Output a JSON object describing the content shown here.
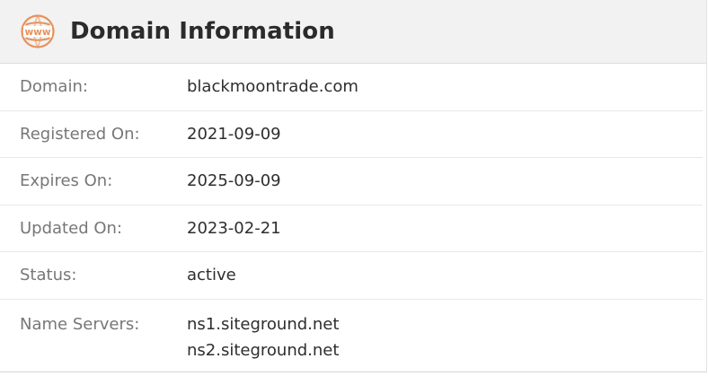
{
  "header": {
    "title": "Domain Information",
    "icon": "www-globe-icon",
    "icon_text": "www",
    "accent": "#e8915a"
  },
  "rows": [
    {
      "label": "Domain:",
      "value": "blackmoontrade.com"
    },
    {
      "label": "Registered On:",
      "value": "2021-09-09"
    },
    {
      "label": "Expires On:",
      "value": "2025-09-09"
    },
    {
      "label": "Updated On:",
      "value": "2023-02-21"
    },
    {
      "label": "Status:",
      "value": "active"
    }
  ],
  "name_servers": {
    "label": "Name Servers:",
    "values": [
      "ns1.siteground.net",
      "ns2.siteground.net"
    ]
  }
}
